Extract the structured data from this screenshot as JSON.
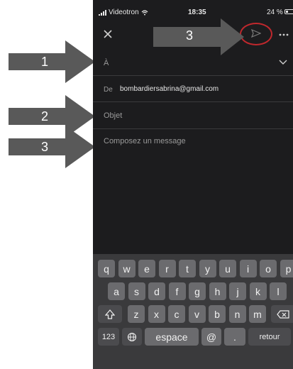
{
  "status_bar": {
    "carrier": "Videotron",
    "time": "18:35",
    "battery": "24 %"
  },
  "toolbar": {
    "close_icon": "close-icon",
    "send_icon": "send-icon",
    "more_icon": "more-options-icon"
  },
  "compose": {
    "to_label": "À",
    "from_label": "De",
    "from_value": "bombardiersabrina@gmail.com",
    "subject_placeholder": "Objet",
    "body_placeholder": "Composez un message"
  },
  "keyboard": {
    "row1": [
      "q",
      "w",
      "e",
      "r",
      "t",
      "y",
      "u",
      "i",
      "o",
      "p"
    ],
    "row2": [
      "a",
      "s",
      "d",
      "f",
      "g",
      "h",
      "j",
      "k",
      "l"
    ],
    "row3": [
      "z",
      "x",
      "c",
      "v",
      "b",
      "n",
      "m"
    ],
    "numbers_key": "123",
    "globe_key": "globe-icon",
    "space_key": "espace",
    "at_key": "@",
    "period_key": ".",
    "return_key": "retour"
  },
  "annotations": {
    "arrow1": "1",
    "arrow2": "2",
    "arrow3_body": "3",
    "arrow3_send": "3",
    "highlight_color": "#c0282d",
    "arrow_color": "#595959"
  }
}
